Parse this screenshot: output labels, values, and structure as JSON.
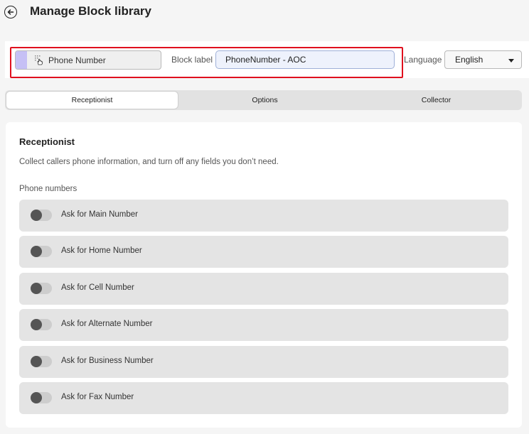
{
  "header": {
    "title": "Manage Block library"
  },
  "toolbar": {
    "block_name": "Phone Number",
    "block_label_caption": "Block label",
    "block_label_value": "PhoneNumber - AOC",
    "language_caption": "Language",
    "language_value": "English"
  },
  "colors": {
    "highlight_border": "#e0101e",
    "chip_accent": "#c6c0f5",
    "input_background": "#eef2fc"
  },
  "tabs": [
    {
      "label": "Receptionist",
      "active": true
    },
    {
      "label": "Options",
      "active": false
    },
    {
      "label": "Collector",
      "active": false
    }
  ],
  "panel": {
    "title": "Receptionist",
    "description": "Collect callers phone information, and turn off any fields you don’t need.",
    "group_label": "Phone numbers",
    "toggles": [
      {
        "label": "Ask for Main Number",
        "on": false
      },
      {
        "label": "Ask for Home Number",
        "on": false
      },
      {
        "label": "Ask for Cell Number",
        "on": false
      },
      {
        "label": "Ask for Alternate Number",
        "on": false
      },
      {
        "label": "Ask for Business Number",
        "on": false
      },
      {
        "label": "Ask for Fax Number",
        "on": false
      }
    ]
  }
}
